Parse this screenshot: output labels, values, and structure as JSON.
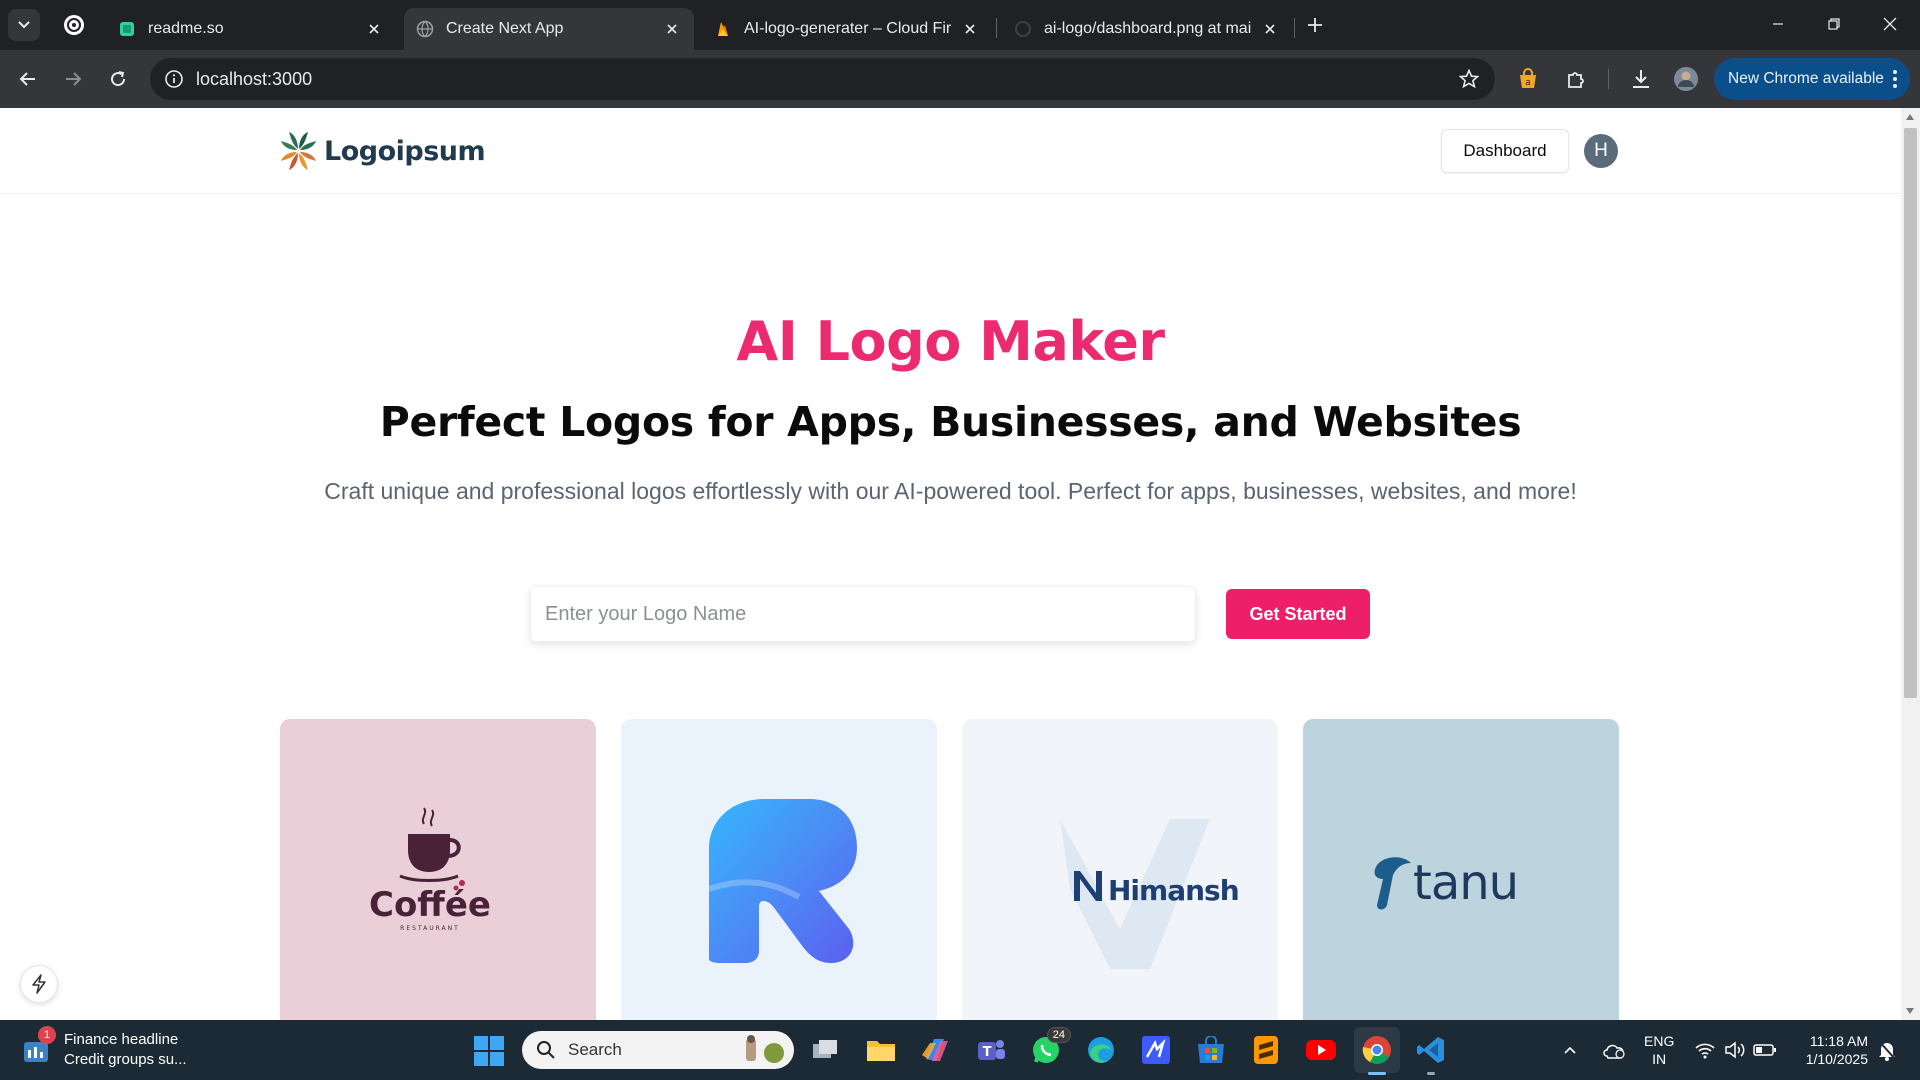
{
  "browser": {
    "pinned_tab_title": "ChatGPT",
    "tabs": [
      {
        "title": "readme.so",
        "active": false
      },
      {
        "title": "Create Next App",
        "active": true
      },
      {
        "title": "AI-logo-generater – Cloud Firestore",
        "active": false
      },
      {
        "title": "ai-logo/dashboard.png at main",
        "active": false
      }
    ],
    "url": "localhost:3000",
    "update_label": "New Chrome available"
  },
  "site": {
    "brand_name": "Logoipsum",
    "dashboard_label": "Dashboard",
    "avatar_initial": "H",
    "hero_title": "AI Logo Maker",
    "hero_subtitle": "Perfect Logos for Apps, Businesses, and Websites",
    "hero_description": "Craft unique and professional logos effortlessly with our AI-powered tool. Perfect for apps, businesses, websites, and more!",
    "input_placeholder": "Enter your Logo Name",
    "input_value": "",
    "cta_label": "Get Started",
    "accent_color": "#ec1f68",
    "examples": [
      {
        "name": "coffee",
        "text": "Coffée",
        "subtext": "RESTAURANT"
      },
      {
        "name": "letter-r",
        "text": ""
      },
      {
        "name": "himanshu",
        "text": "Himanshu"
      },
      {
        "name": "tanu",
        "text": "tanu"
      }
    ]
  },
  "taskbar": {
    "widget_title": "Finance headline",
    "widget_subtitle": "Credit groups su...",
    "widget_badge": "1",
    "search_label": "Search",
    "whatsapp_badge": "24",
    "lang_line1": "ENG",
    "lang_line2": "IN",
    "time": "11:18 AM",
    "date": "1/10/2025"
  }
}
